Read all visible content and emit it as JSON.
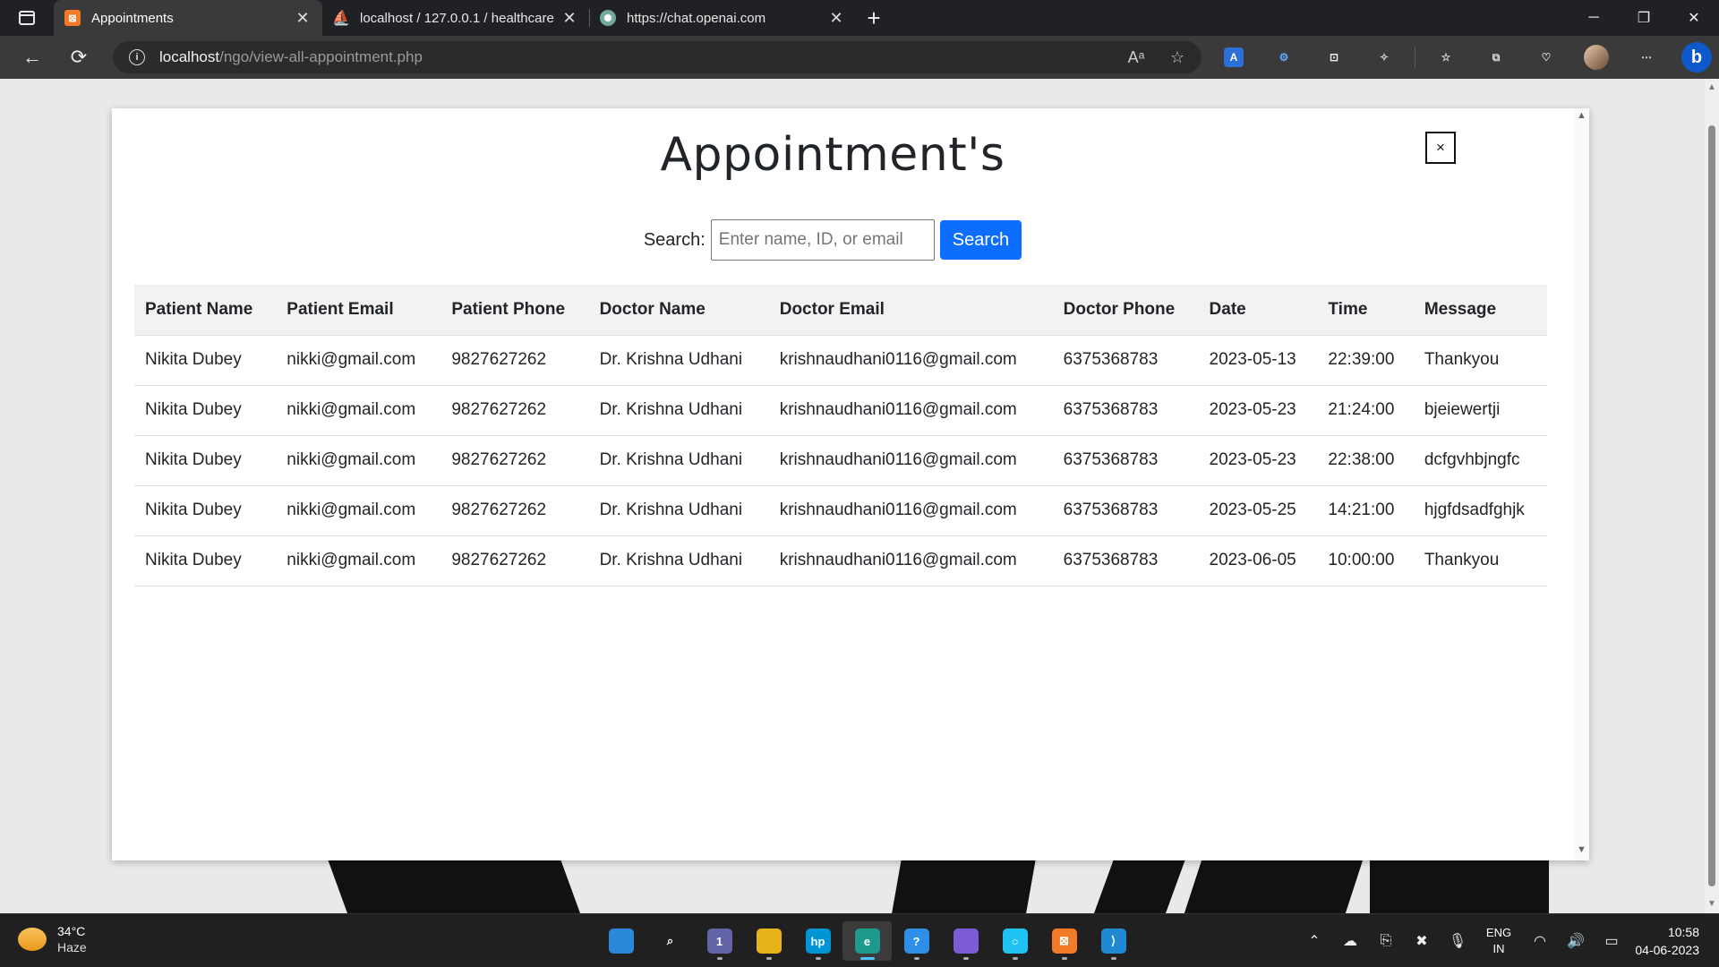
{
  "browser": {
    "tabs": [
      {
        "title": "Appointments",
        "favicon": "xampp-icon",
        "color": "#f37b27",
        "active": true
      },
      {
        "title": "localhost / 127.0.0.1 / healthcare",
        "favicon": "phpmyadmin-icon",
        "color": "#f5a623",
        "active": false
      },
      {
        "title": "https://chat.openai.com",
        "favicon": "openai-icon",
        "color": "#74aa9c",
        "active": false
      }
    ],
    "address": {
      "host": "localhost",
      "path": "/ngo/view-all-appointment.php"
    }
  },
  "modal": {
    "title": "Appointment's",
    "close_label": "×",
    "search": {
      "label": "Search:",
      "placeholder": "Enter name, ID, or email",
      "button": "Search"
    },
    "columns": [
      "Patient Name",
      "Patient Email",
      "Patient Phone",
      "Doctor Name",
      "Doctor Email",
      "Doctor Phone",
      "Date",
      "Time",
      "Message"
    ],
    "rows": [
      [
        "Nikita Dubey",
        "nikki@gmail.com",
        "9827627262",
        "Dr. Krishna Udhani",
        "krishnaudhani0116@gmail.com",
        "6375368783",
        "2023-05-13",
        "22:39:00",
        "Thankyou"
      ],
      [
        "Nikita Dubey",
        "nikki@gmail.com",
        "9827627262",
        "Dr. Krishna Udhani",
        "krishnaudhani0116@gmail.com",
        "6375368783",
        "2023-05-23",
        "21:24:00",
        "bjeiewertji"
      ],
      [
        "Nikita Dubey",
        "nikki@gmail.com",
        "9827627262",
        "Dr. Krishna Udhani",
        "krishnaudhani0116@gmail.com",
        "6375368783",
        "2023-05-23",
        "22:38:00",
        "dcfgvhbjngfc"
      ],
      [
        "Nikita Dubey",
        "nikki@gmail.com",
        "9827627262",
        "Dr. Krishna Udhani",
        "krishnaudhani0116@gmail.com",
        "6375368783",
        "2023-05-25",
        "14:21:00",
        "hjgfdsadfghjk"
      ],
      [
        "Nikita Dubey",
        "nikki@gmail.com",
        "9827627262",
        "Dr. Krishna Udhani",
        "krishnaudhani0116@gmail.com",
        "6375368783",
        "2023-06-05",
        "10:00:00",
        "Thankyou"
      ]
    ]
  },
  "taskbar": {
    "weather": {
      "temp": "34°C",
      "condition": "Haze"
    },
    "apps": [
      {
        "name": "windows-start-icon",
        "color": "#2b88d8",
        "label": ""
      },
      {
        "name": "search-icon",
        "color": "transparent",
        "label": "⌕"
      },
      {
        "name": "teams-chat-icon",
        "color": "#6264a7",
        "label": "1"
      },
      {
        "name": "file-explorer-icon",
        "color": "#e8b21a",
        "label": ""
      },
      {
        "name": "myhp-icon",
        "color": "#0096d6",
        "label": "hp"
      },
      {
        "name": "edge-browser-icon",
        "color": "#1d9a8b",
        "label": "e"
      },
      {
        "name": "get-help-icon",
        "color": "#2f8fe8",
        "label": "?"
      },
      {
        "name": "copilot-icon",
        "color": "#7b5cd6",
        "label": ""
      },
      {
        "name": "alexa-icon",
        "color": "#1fc3f2",
        "label": "○"
      },
      {
        "name": "xampp-icon",
        "color": "#f37b27",
        "label": "⊠"
      },
      {
        "name": "vscode-icon",
        "color": "#1f8ad2",
        "label": "⟩"
      }
    ],
    "language": {
      "line1": "ENG",
      "line2": "IN"
    },
    "clock": {
      "time": "10:58",
      "date": "04-06-2023"
    }
  }
}
